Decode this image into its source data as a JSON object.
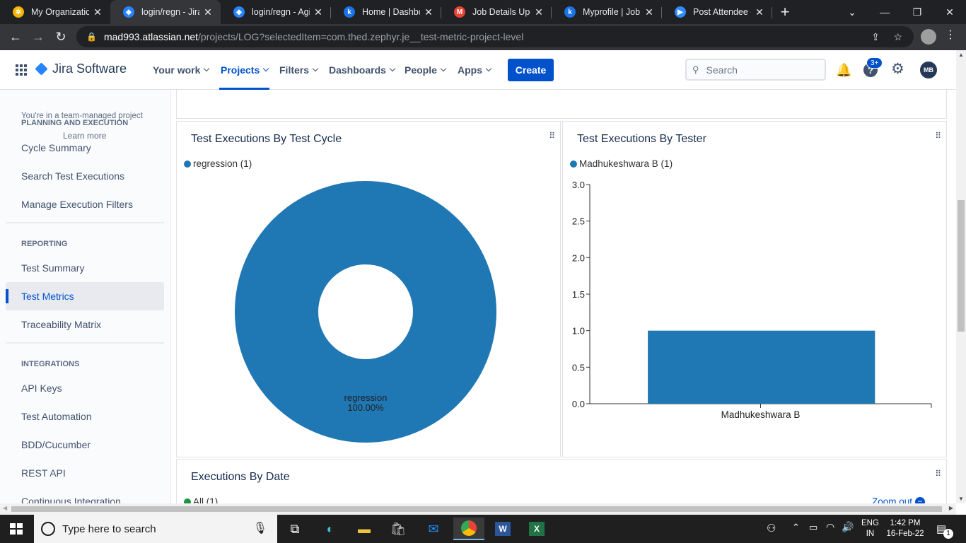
{
  "browser": {
    "tabs": [
      {
        "title": "My Organization",
        "color": "#f4b400",
        "glyph": "✲"
      },
      {
        "title": "login/regn - Jira",
        "color": "#2684ff",
        "glyph": "◆"
      },
      {
        "title": "login/regn - Agile",
        "color": "#2684ff",
        "glyph": "◆"
      },
      {
        "title": "Home | Dashboard",
        "color": "#1a73e8",
        "glyph": "k"
      },
      {
        "title": "Job Details Upda",
        "color": "#ea4335",
        "glyph": "M"
      },
      {
        "title": "Myprofile | Job",
        "color": "#1a73e8",
        "glyph": "k"
      },
      {
        "title": "Post Attendee - Z",
        "color": "#2d8cff",
        "glyph": "▶"
      }
    ],
    "url_host": "mad993.atlassian.net",
    "url_path": "/projects/LOG?selectedItem=com.thed.zephyr.je__test-metric-project-level"
  },
  "jira": {
    "brand": "Jira Software",
    "menu": [
      {
        "label": "Your work"
      },
      {
        "label": "Projects"
      },
      {
        "label": "Filters"
      },
      {
        "label": "Dashboards"
      },
      {
        "label": "People"
      },
      {
        "label": "Apps"
      }
    ],
    "create_label": "Create",
    "search_placeholder": "Search",
    "help_badge": "3+",
    "avatar": "MB"
  },
  "sidebar": {
    "team_note": "You're in a team-managed project",
    "learn_more": "Learn more",
    "planning_header": "PLANNING AND EXECUTION",
    "planning_items": [
      "Cycle Summary",
      "Search Test Executions",
      "Manage Execution Filters"
    ],
    "reporting_header": "REPORTING",
    "reporting_items": [
      "Test Summary",
      "Test Metrics",
      "Traceability Matrix"
    ],
    "integrations_header": "INTEGRATIONS",
    "integration_items": [
      "API Keys",
      "Test Automation",
      "BDD/Cucumber",
      "REST API",
      "Continuous Integration"
    ]
  },
  "accent": "#1f77b4",
  "chart_data": [
    {
      "type": "pie",
      "title": "Test Executions By Test Cycle",
      "legend": [
        "regression (1)"
      ],
      "categories": [
        "regression"
      ],
      "values": [
        1
      ],
      "slice_label": "regression",
      "slice_percent": "100.00%",
      "donut": true
    },
    {
      "type": "bar",
      "title": "Test Executions By Tester",
      "legend": [
        "Madhukeshwara B (1)"
      ],
      "categories": [
        "Madhukeshwara B"
      ],
      "values": [
        1
      ],
      "ylim": [
        0,
        3
      ],
      "yticks": [
        "3.0",
        "2.5",
        "2.0",
        "1.5",
        "1.0",
        "0.5",
        "0.0"
      ]
    },
    {
      "type": "line",
      "title": "Executions By Date",
      "legend": [
        "All (1)"
      ],
      "zoom_label": "Zoom out"
    }
  ],
  "taskbar": {
    "search_placeholder": "Type here to search",
    "lang": "ENG",
    "region": "IN",
    "time": "1:42 PM",
    "date": "16-Feb-22",
    "notif_count": "1"
  }
}
